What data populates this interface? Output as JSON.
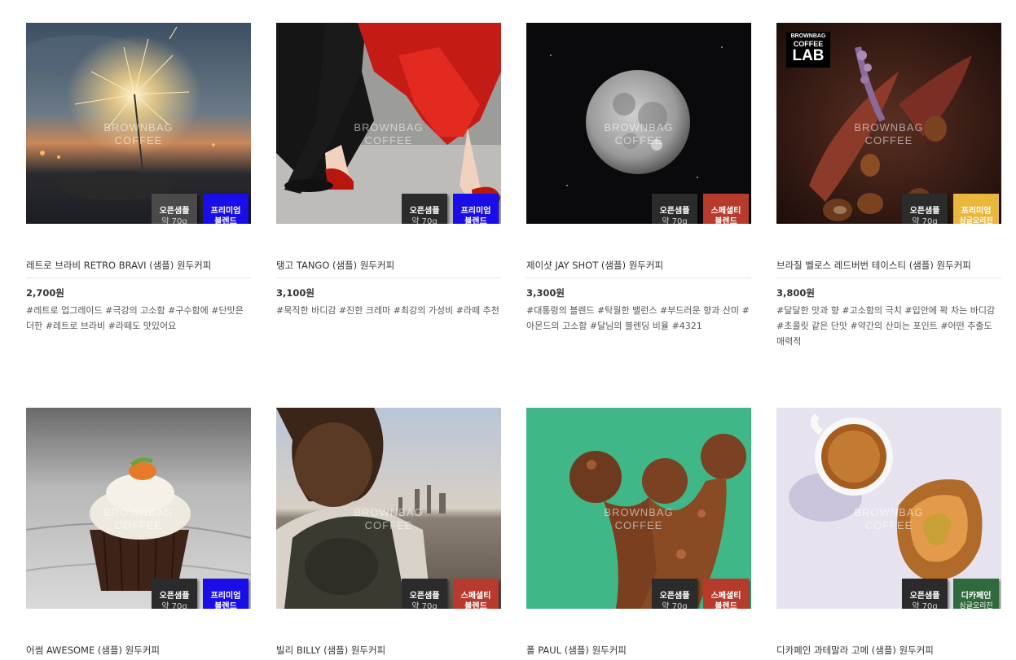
{
  "products": [
    {
      "title": "레트로 브라비 RETRO BRAVI (샘플) 원두커피",
      "price": "2,700원",
      "tags": "#레트로 업그레이드 #극강의 고소함 #구수함에 #단맛은 더한 #레트로 브라비 #라떼도 맛있어요",
      "watermark_1": "BROWNBAG",
      "watermark_2": "COFFEE",
      "image_icon": "sparkler-photo",
      "badges": [
        {
          "line1": "오픈샘플",
          "line2": "약 70g",
          "color": "#4a4a4a"
        },
        {
          "line1": "프리미엄",
          "line2": "블렌드",
          "color": "#1a0ee8"
        }
      ]
    },
    {
      "title": "탱고 TANGO (샘플) 원두커피",
      "price": "3,100원",
      "tags": "#묵직한 바디감 #진한 크레마 #최강의 가성비 #라떼 추천",
      "watermark_1": "BROWNBAG",
      "watermark_2": "COFFEE",
      "image_icon": "tango-dancers-photo",
      "badges": [
        {
          "line1": "오픈샘플",
          "line2": "약 70g",
          "color": "#2b2b2b"
        },
        {
          "line1": "프리미엄",
          "line2": "블렌드",
          "color": "#1a0ee8"
        }
      ]
    },
    {
      "title": "제이샷 JAY SHOT (샘플) 원두커피",
      "price": "3,300원",
      "tags": "#대통령의 블렌드 #탁월한 밸런스 #부드러운 향과 산미 #아몬드의 고소함 #달님의 블렌딩 비율 #4321",
      "watermark_1": "BROWNBAG",
      "watermark_2": "COFFEE",
      "image_icon": "moon-photo",
      "badges": [
        {
          "line1": "오픈샘플",
          "line2": "약 70g",
          "color": "#2b2b2b"
        },
        {
          "line1": "스페셜티",
          "line2": "블렌드",
          "color": "#b83a2c"
        }
      ]
    },
    {
      "title": "브라질 벨로스 레드버번 테이스티 (샘플) 원두커피",
      "price": "3,800원",
      "tags": "#달달한 맛과 향 #고소함의 극치 #입안에 꽉 차는 바디감 #초콜릿 같은 단맛 #약간의 산미는 포인트 #어떤 추출도 매력적",
      "watermark_1": "BROWNBAG",
      "watermark_2": "COFFEE",
      "image_icon": "chestnuts-photo",
      "logo": {
        "line1": "BROWNBAG",
        "line2": "COFFEE",
        "line3": "LAB"
      },
      "badges": [
        {
          "line1": "오픈샘플",
          "line2": "약 70g",
          "color": "#2b2b2b"
        },
        {
          "line1": "프리미엄",
          "line2": "싱글오리진",
          "color": "#e9b73c"
        }
      ]
    },
    {
      "title": "어썸 AWESOME (샘플) 원두커피",
      "watermark_1": "BROWNBAG",
      "watermark_2": "COFFEE",
      "image_icon": "cupcake-photo",
      "badges": [
        {
          "line1": "오픈샘플",
          "line2": "약 70g",
          "color": "#2b2b2b"
        },
        {
          "line1": "프리미엄",
          "line2": "블렌드",
          "color": "#1a0ee8"
        }
      ]
    },
    {
      "title": "빌리 BILLY (샘플) 원두커피",
      "watermark_1": "BROWNBAG",
      "watermark_2": "COFFEE",
      "image_icon": "backpacker-city-photo",
      "badges": [
        {
          "line1": "오픈샘플",
          "line2": "약 70g",
          "color": "#2b2b2b"
        },
        {
          "line1": "스페셜티",
          "line2": "블렌드",
          "color": "#b83a2c"
        }
      ]
    },
    {
      "title": "폴 PAUL (샘플) 원두커피",
      "watermark_1": "BROWNBAG",
      "watermark_2": "COFFEE",
      "image_icon": "rusty-crown-photo",
      "badges": [
        {
          "line1": "오픈샘플",
          "line2": "약 70g",
          "color": "#2b2b2b"
        },
        {
          "line1": "스페셜티",
          "line2": "블렌드",
          "color": "#b83a2c"
        }
      ]
    },
    {
      "title": "디카페인 과테말라 고메 (샘플) 원두커피",
      "watermark_1": "BROWNBAG",
      "watermark_2": "COFFEE",
      "image_icon": "espresso-cup-photo",
      "badges": [
        {
          "line1": "오픈샘플",
          "line2": "약 70g",
          "color": "#2b2b2b"
        },
        {
          "line1": "디카페인",
          "line2": "싱글오리진",
          "color": "#2f6a3c"
        }
      ]
    }
  ]
}
